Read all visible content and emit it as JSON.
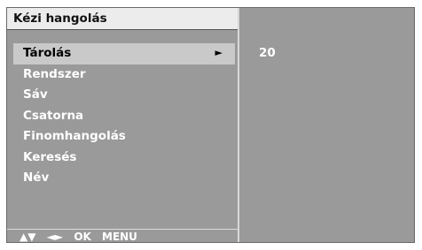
{
  "title": "Kézi hangolás",
  "menu": {
    "items": [
      {
        "label": "Tárolás",
        "selected": true
      },
      {
        "label": "Rendszer"
      },
      {
        "label": "Sáv"
      },
      {
        "label": "Csatorna"
      },
      {
        "label": "Finomhangolás"
      },
      {
        "label": "Keresés"
      },
      {
        "label": "Név"
      }
    ],
    "arrow": "►"
  },
  "value_panel": {
    "value": "20"
  },
  "footer": {
    "updown": "▲▼",
    "leftright": "◄►",
    "ok": "OK",
    "menu": "MENU"
  },
  "colors": {
    "panel": "#9a9a9a",
    "title_bar": "#ececec",
    "selected": "#c9c9c9",
    "text": "#ffffff"
  }
}
